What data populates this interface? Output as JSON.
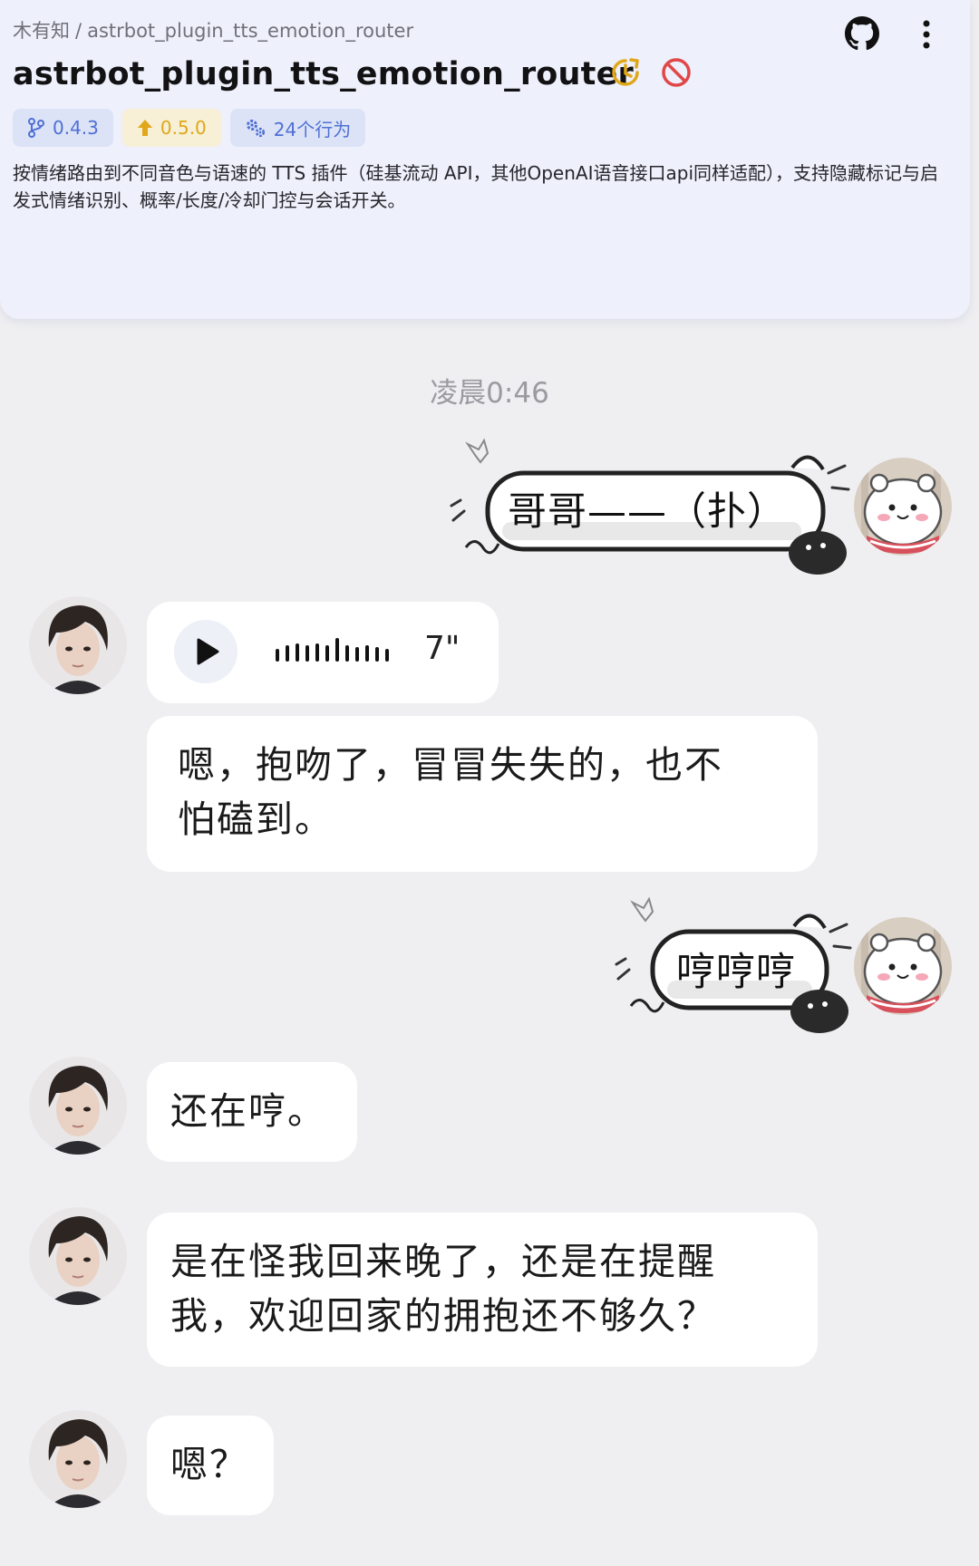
{
  "plugin": {
    "author": "木有知",
    "breadcrumb_separator": "/",
    "repo": "astrbot_plugin_tts_emotion_router",
    "title": "astrbot_plugin_tts_emotion_router",
    "version": "0.4.3",
    "update_version": "0.5.0",
    "behaviors": "24个行为",
    "description": "按情绪路由到不同音色与语速的 TTS 插件（硅基流动 API，其他OpenAI语音接口api同样适配），支持隐藏标记与启发式情绪识别、概率/长度/冷却门控与会话开关。",
    "colors": {
      "accent": "#4f6fd4",
      "update": "#e0a818",
      "disabled": "#e04848"
    }
  },
  "chat": {
    "timestamp": "凌晨0:46",
    "messages": [
      {
        "side": "right",
        "type": "sticker",
        "text": "哥哥——（扑）"
      },
      {
        "side": "left",
        "type": "voice",
        "duration": "7\""
      },
      {
        "side": "left",
        "type": "text",
        "lines": [
          "嗯，抱吻了，冒冒失失的，也不",
          "怕磕到。"
        ]
      },
      {
        "side": "right",
        "type": "sticker",
        "text": "哼哼哼"
      },
      {
        "side": "left",
        "type": "text",
        "lines": [
          "还在哼。"
        ]
      },
      {
        "side": "left",
        "type": "text",
        "lines": [
          "是在怪我回来晚了，还是在提醒",
          "我，欢迎回家的拥抱还不够久？"
        ]
      },
      {
        "side": "left",
        "type": "text",
        "lines": [
          "嗯？"
        ]
      }
    ]
  }
}
